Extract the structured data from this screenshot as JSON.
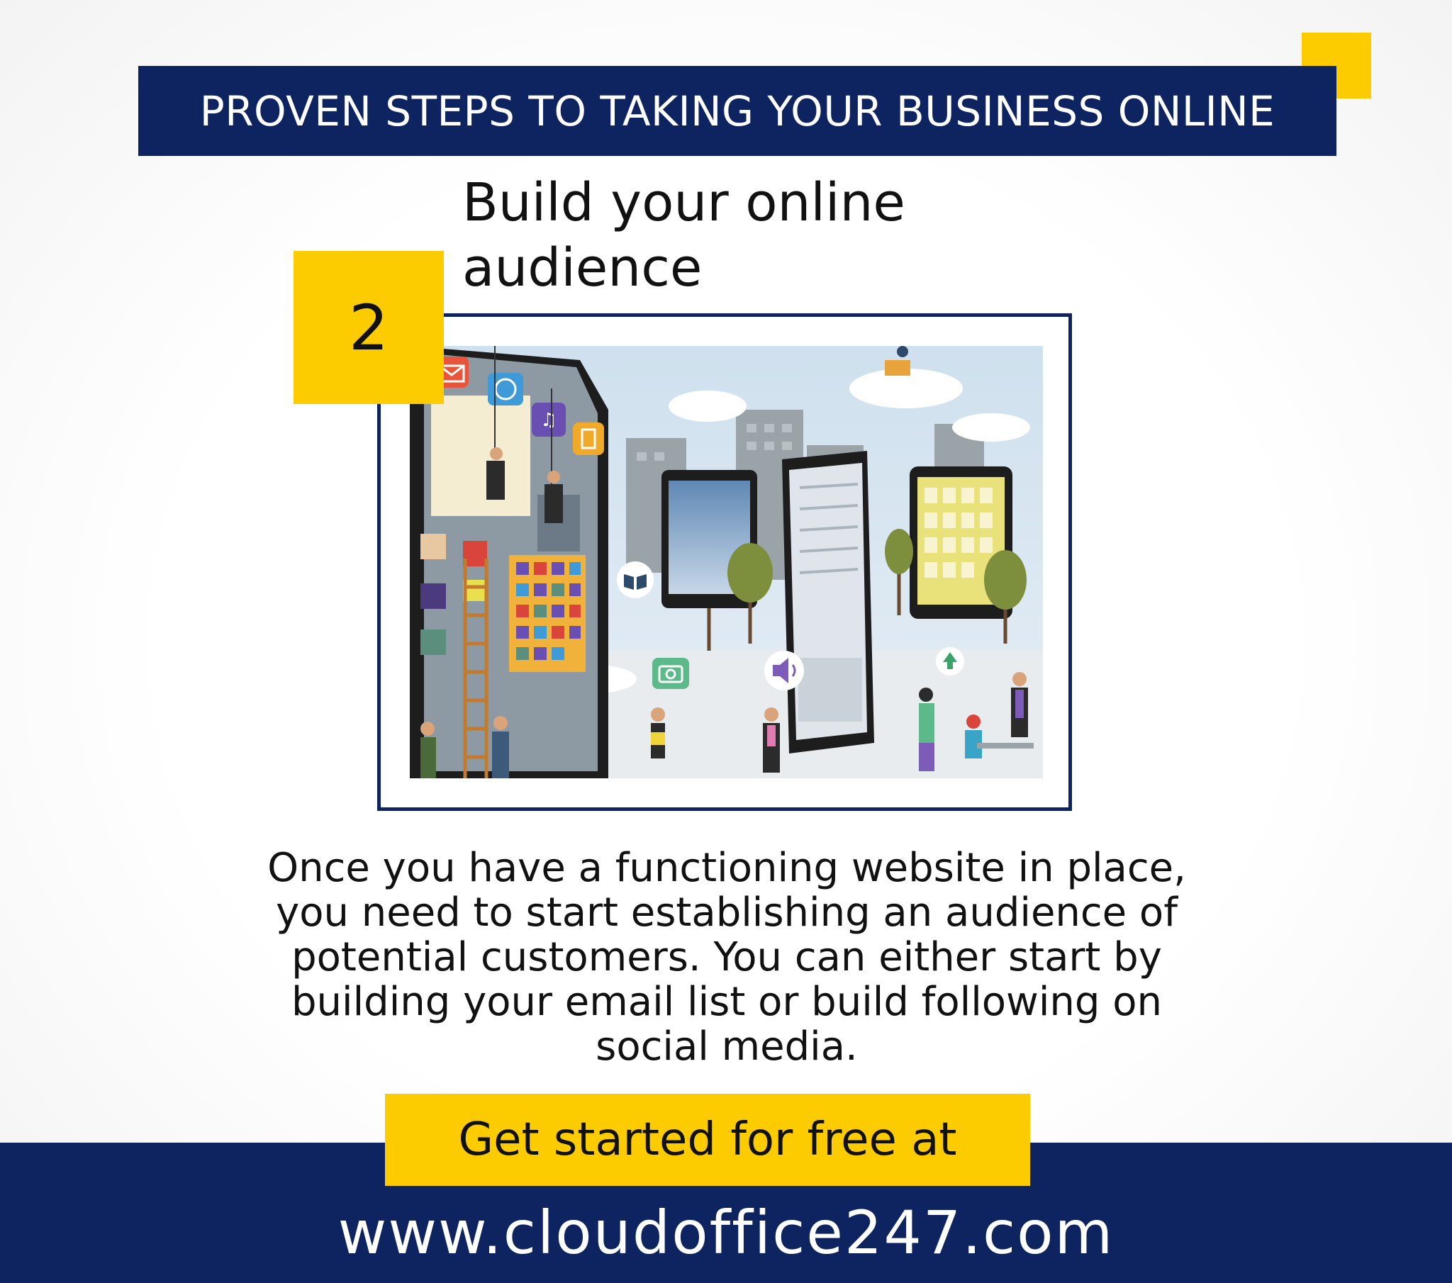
{
  "header": {
    "title": "PROVEN STEPS TO TAKING YOUR BUSINESS ONLINE"
  },
  "step": {
    "number": "2",
    "heading": "Build your online audience"
  },
  "body": {
    "paragraph": "Once you have a functioning website in place, you need to start establishing an audience of potential customers. You can either start by building your email list or build  following on social media."
  },
  "cta": {
    "label": "Get started for free at",
    "url": "www.cloudoffice247.com"
  },
  "colors": {
    "navy": "#0e2461",
    "yellow": "#fccc00"
  },
  "illustration": {
    "icons": [
      "mail-icon",
      "clock-icon",
      "music-icon",
      "file-icon",
      "book-icon",
      "camera-icon",
      "speaker-icon",
      "upload-icon"
    ]
  }
}
